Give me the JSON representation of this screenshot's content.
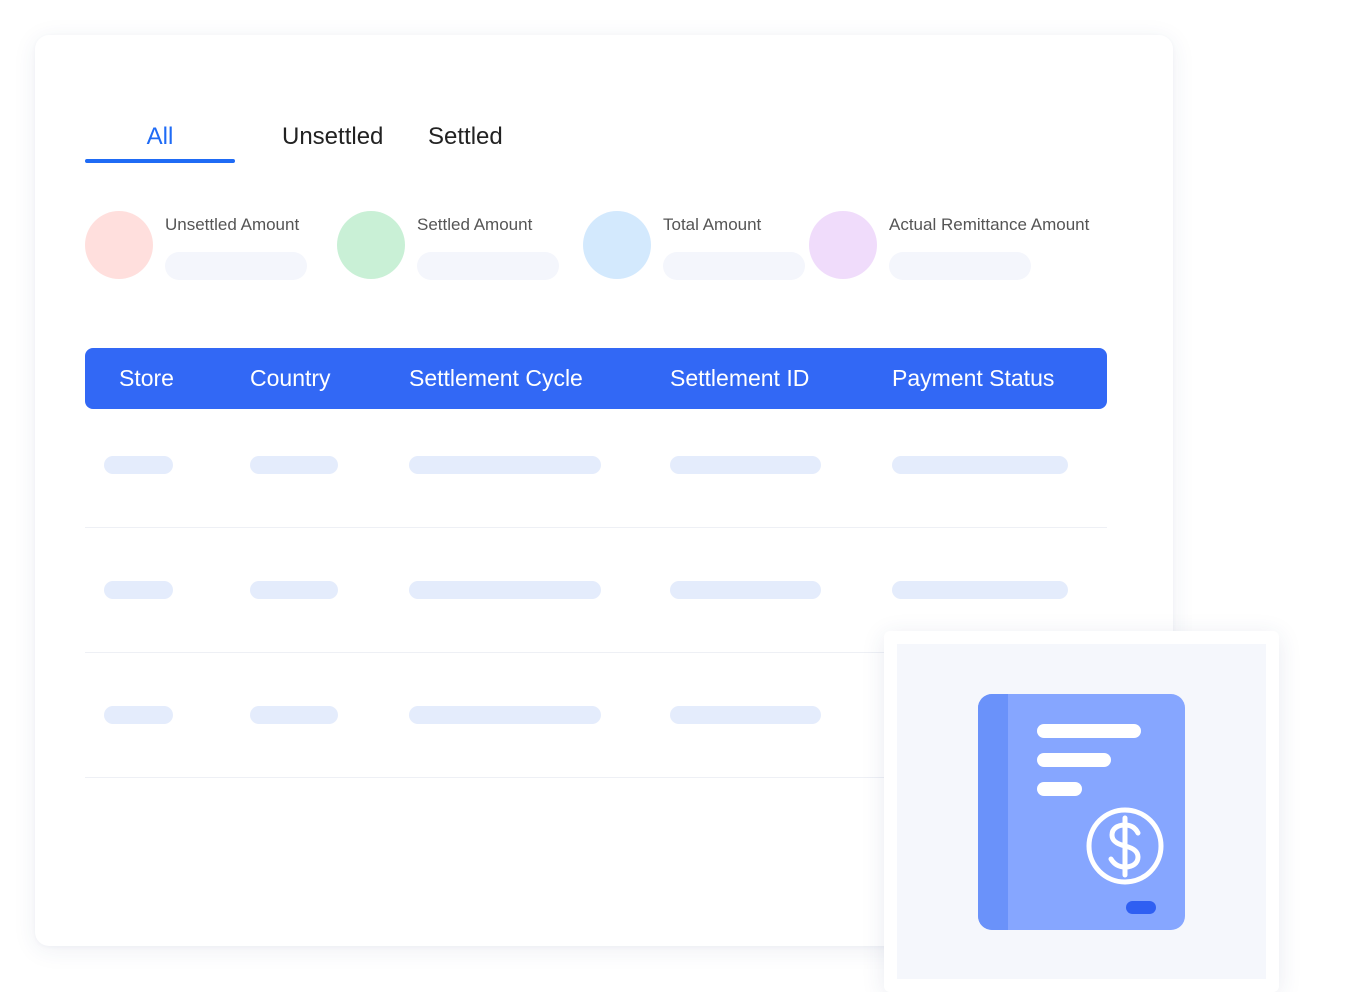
{
  "tabs": {
    "items": [
      {
        "label": "All",
        "active": true
      },
      {
        "label": "Unsettled",
        "active": false
      },
      {
        "label": "Settled",
        "active": false
      }
    ]
  },
  "stats": [
    {
      "label": "Unsettled Amount",
      "color": "#ffdfdd"
    },
    {
      "label": "Settled Amount",
      "color": "#c9f0d6"
    },
    {
      "label": "Total Amount",
      "color": "#d3e9fd"
    },
    {
      "label": "Actual Remittance Amount",
      "color": "#f0dcfb"
    }
  ],
  "table": {
    "columns": [
      "Store",
      "Country",
      "Settlement Cycle",
      "Settlement ID",
      "Payment Status"
    ],
    "header_color": "#3268f5"
  },
  "illustration": {
    "icon": "receipt-dollar-icon",
    "colors": {
      "book": "#86a6ff",
      "spine": "#6a92fa",
      "accent": "#2f5ff2"
    }
  }
}
